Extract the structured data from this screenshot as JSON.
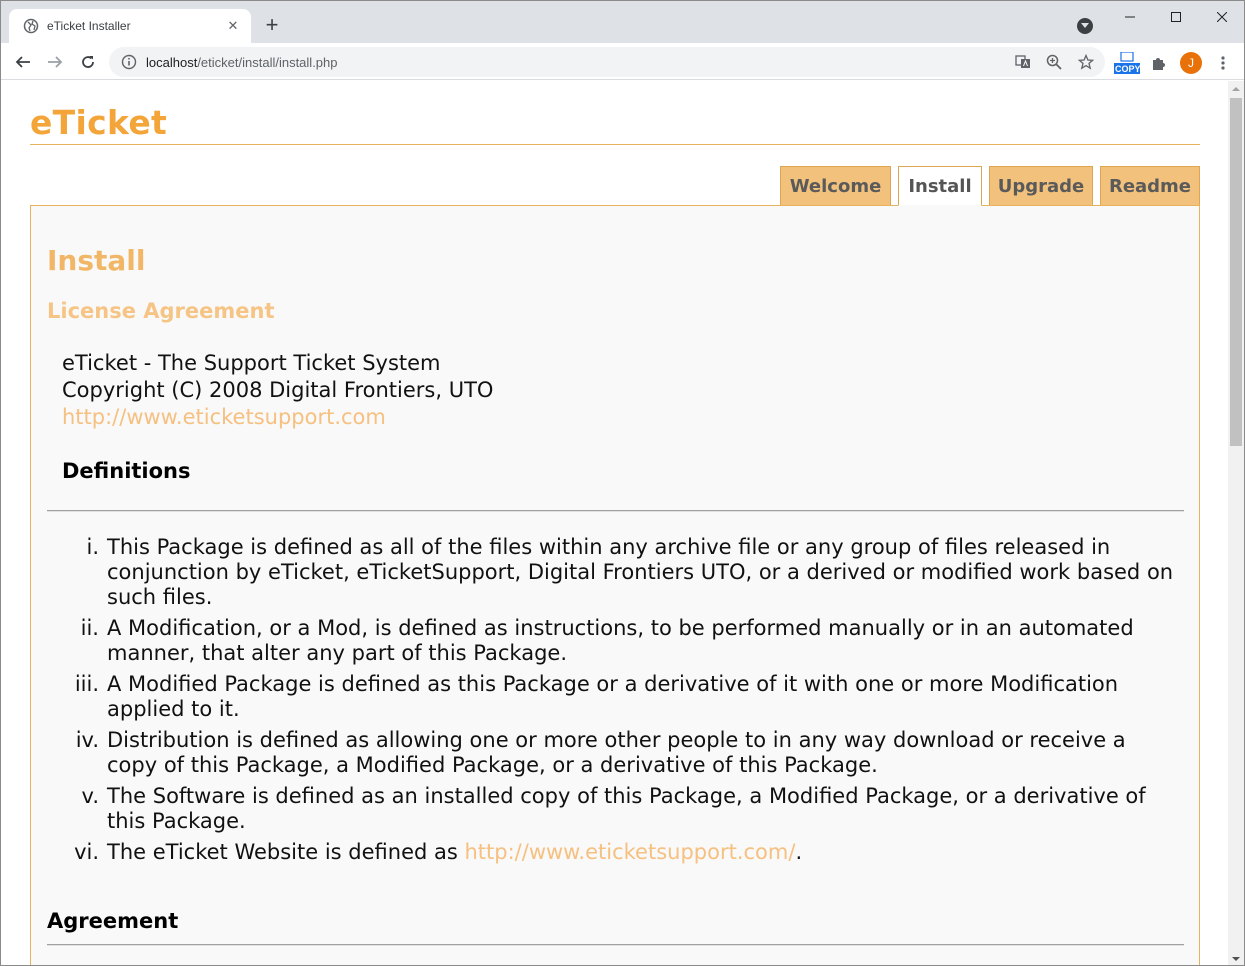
{
  "browser": {
    "tab_title": "eTicket Installer",
    "tab_close": "✕",
    "new_tab": "+",
    "url_host": "localhost",
    "url_path": "/eticket/install/install.php",
    "extension_copy_label": "COPY",
    "avatar_initial": "J"
  },
  "site": {
    "logo": "eTicket",
    "tabs": [
      {
        "label": "Welcome"
      },
      {
        "label": "Install"
      },
      {
        "label": "Upgrade"
      },
      {
        "label": "Readme"
      }
    ],
    "active_tab": "Install"
  },
  "content": {
    "heading": "Install",
    "subheading": "License Agreement",
    "license_lines": [
      "eTicket - The Support Ticket System",
      "Copyright (C) 2008 Digital Frontiers, UTO",
      "http://www.eticketsupport.com"
    ],
    "definitions_heading": "Definitions",
    "definitions": [
      {
        "num": "i.",
        "line1": "This Package is defined as all of the files within any archive file or any group of files released in",
        "line2": "conjunction by eTicket, eTicketSupport, Digital Frontiers UTO, or a derived or modified work based on",
        "line3": "such files."
      },
      {
        "num": "ii.",
        "line1": "A Modification, or a Mod, is defined as instructions, to be performed manually or in an automated",
        "line2": "manner, that alter any part of this Package."
      },
      {
        "num": "iii.",
        "line1": "A Modified Package is defined as this Package or a derivative of it with one or more Modification",
        "line2": "applied to it."
      },
      {
        "num": "iv.",
        "line1": "Distribution is defined as allowing one or more other people to in any way download or receive a",
        "line2": "copy of this Package, a Modified Package, or a derivative of this Package."
      },
      {
        "num": "v.",
        "line1": "The Software is defined as an installed copy of this Package, a Modified Package, or a derivative of",
        "line2": "this Package."
      },
      {
        "num": "vi.",
        "line1": "The eTicket Website is defined as ",
        "link": "http://www.eticketsupport.com/",
        "after": "."
      }
    ],
    "agreement_heading": "Agreement"
  },
  "colors": {
    "accent": "#f3a53a",
    "tab_bg": "#f2c27d",
    "link": "#f6c080"
  }
}
